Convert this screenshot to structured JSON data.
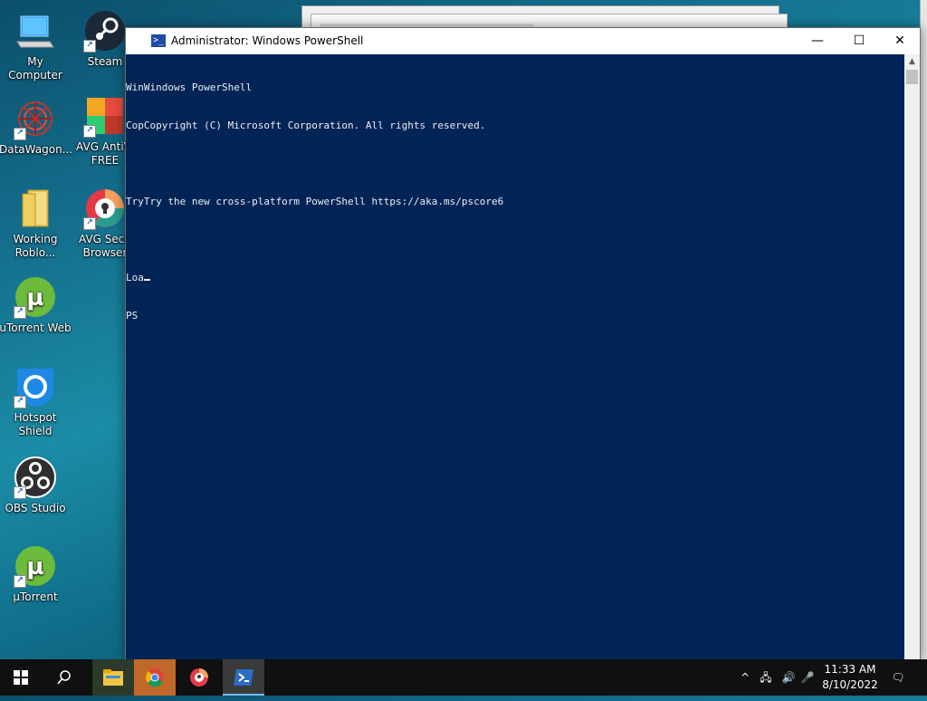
{
  "desktop": {
    "icons": [
      {
        "label": "My Computer",
        "icon": "computer-icon"
      },
      {
        "label": "Steam",
        "icon": "steam-icon"
      },
      {
        "label": "DataWagon...",
        "icon": "datawagon-icon"
      },
      {
        "label": "AVG AntiVi FREE",
        "icon": "avg-antivirus-icon"
      },
      {
        "label": "Working Roblo...",
        "icon": "folder-icon"
      },
      {
        "label": "AVG Secu Browser",
        "icon": "avg-browser-icon"
      },
      {
        "label": "uTorrent Web",
        "icon": "utorrent-web-icon"
      },
      {
        "label": "Hotspot Shield",
        "icon": "hotspot-shield-icon"
      },
      {
        "label": "OBS Studio",
        "icon": "obs-icon"
      },
      {
        "label": "µTorrent",
        "icon": "utorrent-icon"
      }
    ]
  },
  "window": {
    "title": "Administrator: Windows PowerShell",
    "minimize": "—",
    "maximize": "☐",
    "close": "✕"
  },
  "console": {
    "lines": [
      "WinWindows PowerShell",
      "CopCopyright (C) Microsoft Corporation. All rights reserved.",
      "",
      "TryTry the new cross-platform PowerShell https://aka.ms/pscore6",
      "",
      "Loa",
      "PS"
    ]
  },
  "taskbar": {
    "start": "⊞",
    "search": "⌕",
    "apps": [
      "file-explorer-icon",
      "chrome-icon",
      "avg-browser-icon",
      "powershell-icon"
    ],
    "tray": {
      "chevron": "^",
      "network": "🖧",
      "volume": "🔊",
      "mic": "🎤",
      "notification": "🗨"
    },
    "time": "11:33 AM",
    "date": "8/10/2022"
  },
  "colors": {
    "console_bg": "#012456",
    "console_fg": "#eeedf0",
    "taskbar_bg": "#101010"
  }
}
